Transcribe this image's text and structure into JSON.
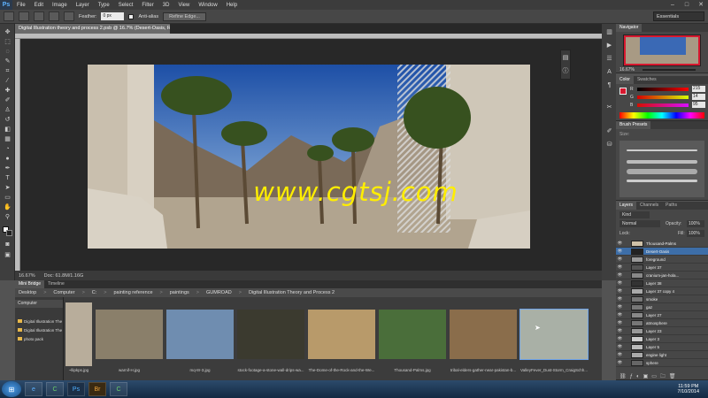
{
  "app": {
    "logo": "Ps"
  },
  "menu": [
    "File",
    "Edit",
    "Image",
    "Layer",
    "Type",
    "Select",
    "Filter",
    "3D",
    "View",
    "Window",
    "Help"
  ],
  "window_controls": [
    "–",
    "□",
    "✕"
  ],
  "options": {
    "feather_label": "Feather:",
    "feather_value": "0 px",
    "antialias_label": "Anti-alias",
    "refine_label": "Refine Edge...",
    "workspace": "Essentials"
  },
  "document": {
    "tab_title": "Digital Illustration theory and process 2.psb @ 16.7% (Desert-Oasis, RGB/8)",
    "zoom": "16.67%",
    "doc_size": "Doc: 61.8M/1.16G"
  },
  "watermark": "www.cgtsj.com",
  "navigator": {
    "tab": "Navigator",
    "zoom": "16.67%"
  },
  "color": {
    "tabs": [
      "Color",
      "Swatches"
    ],
    "channels": [
      {
        "label": "R",
        "value": "215"
      },
      {
        "label": "G",
        "value": "14"
      },
      {
        "label": "B",
        "value": "95"
      }
    ]
  },
  "brush_presets": {
    "tab": "Brush Presets",
    "size_label": "Size:"
  },
  "layers": {
    "tabs": [
      "Layers",
      "Channels",
      "Paths"
    ],
    "kind": "Kind",
    "blend": "Normal",
    "opacity_label": "Opacity:",
    "opacity": "100%",
    "lock_label": "Lock:",
    "fill_label": "Fill:",
    "fill": "100%",
    "items": [
      {
        "name": "Thousand-Palms"
      },
      {
        "name": "Desert-Oasis"
      },
      {
        "name": "foreground"
      },
      {
        "name": "Layer 37"
      },
      {
        "name": "cranium-jan-hola..."
      },
      {
        "name": "Layer 38"
      },
      {
        "name": "Layer 37 copy 4"
      },
      {
        "name": "smoke"
      },
      {
        "name": "gaz"
      },
      {
        "name": "Layer 27"
      },
      {
        "name": "atmosphere"
      },
      {
        "name": "Layer 23"
      },
      {
        "name": "Layer 3"
      },
      {
        "name": "Layer 5"
      },
      {
        "name": "engine light"
      },
      {
        "name": "sphere"
      }
    ]
  },
  "bridge": {
    "tabs": [
      "Mini Bridge",
      "Timeline"
    ],
    "path": [
      "Desktop",
      "Computer",
      "C:",
      "painting reference",
      "paintings",
      "GUMROAD",
      "Digital Illustration Theory and Process 2"
    ],
    "folder_header": "Computer",
    "folders": [
      "Digital Illustration The",
      "Digital Illustration The",
      "photo pack"
    ],
    "thumbnails": [
      {
        "caption": "~llipkps.jpg"
      },
      {
        "caption": "warnif-H.jpg"
      },
      {
        "caption": "mq-8r-3.jpg"
      },
      {
        "caption": "stock-footage-a-stone-wall-drips-wa..."
      },
      {
        "caption": "The-Dome-of-the-Rock-and-the-We..."
      },
      {
        "caption": "Thousand-Palms.jpg"
      },
      {
        "caption": "tribal-elders-gather-near-pakistan-b..."
      },
      {
        "caption": "ValleyFever_Dust-Storm_CraigSchh..."
      }
    ]
  },
  "taskbar": {
    "time": "11:59 PM",
    "date": "7/10/2014",
    "apps": [
      "e",
      "C",
      "Ps",
      "Br",
      "C"
    ]
  },
  "colors": {
    "accent": "#ffee00",
    "selection": "#d7182f"
  }
}
